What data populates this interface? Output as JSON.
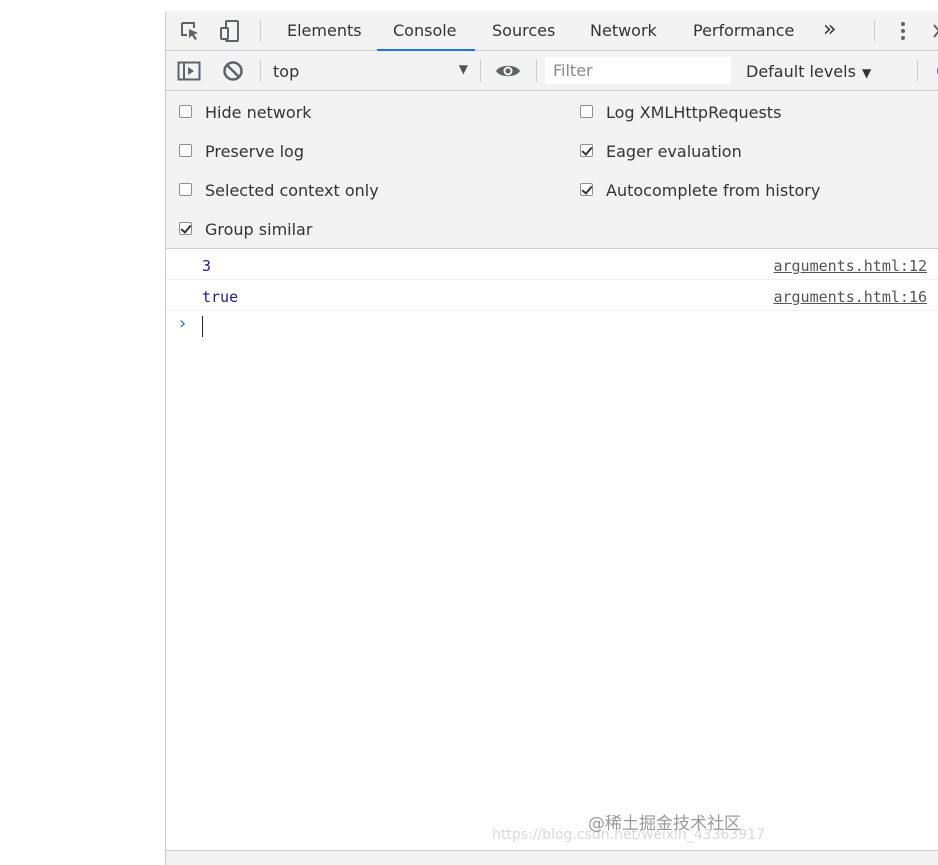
{
  "tabs": {
    "inspect_icon": "inspect-element-icon",
    "device_icon": "device-toolbar-icon",
    "items": [
      {
        "label": "Elements"
      },
      {
        "label": "Console"
      },
      {
        "label": "Sources"
      },
      {
        "label": "Network"
      },
      {
        "label": "Performance"
      }
    ],
    "active_index": 1,
    "more": "»",
    "accent_color": "#1a73e8"
  },
  "toolbar": {
    "context": "top",
    "filter_placeholder": "Filter",
    "levels": "Default levels",
    "dropdown_arrow": "▼"
  },
  "settings": {
    "items": [
      {
        "label": "Hide network",
        "checked": false
      },
      {
        "label": "Log XMLHttpRequests",
        "checked": false
      },
      {
        "label": "Preserve log",
        "checked": false
      },
      {
        "label": "Eager evaluation",
        "checked": true
      },
      {
        "label": "Selected context only",
        "checked": false
      },
      {
        "label": "Autocomplete from history",
        "checked": true
      },
      {
        "label": "Group similar",
        "checked": true
      }
    ]
  },
  "console": {
    "messages": [
      {
        "value": "3",
        "source": "arguments.html:12"
      },
      {
        "value": "true",
        "source": "arguments.html:16"
      }
    ],
    "prompt_symbol": "›"
  },
  "watermark": {
    "text": "@稀土掘金技术社区",
    "url": "https://blog.csdn.net/weixin_43363917"
  }
}
